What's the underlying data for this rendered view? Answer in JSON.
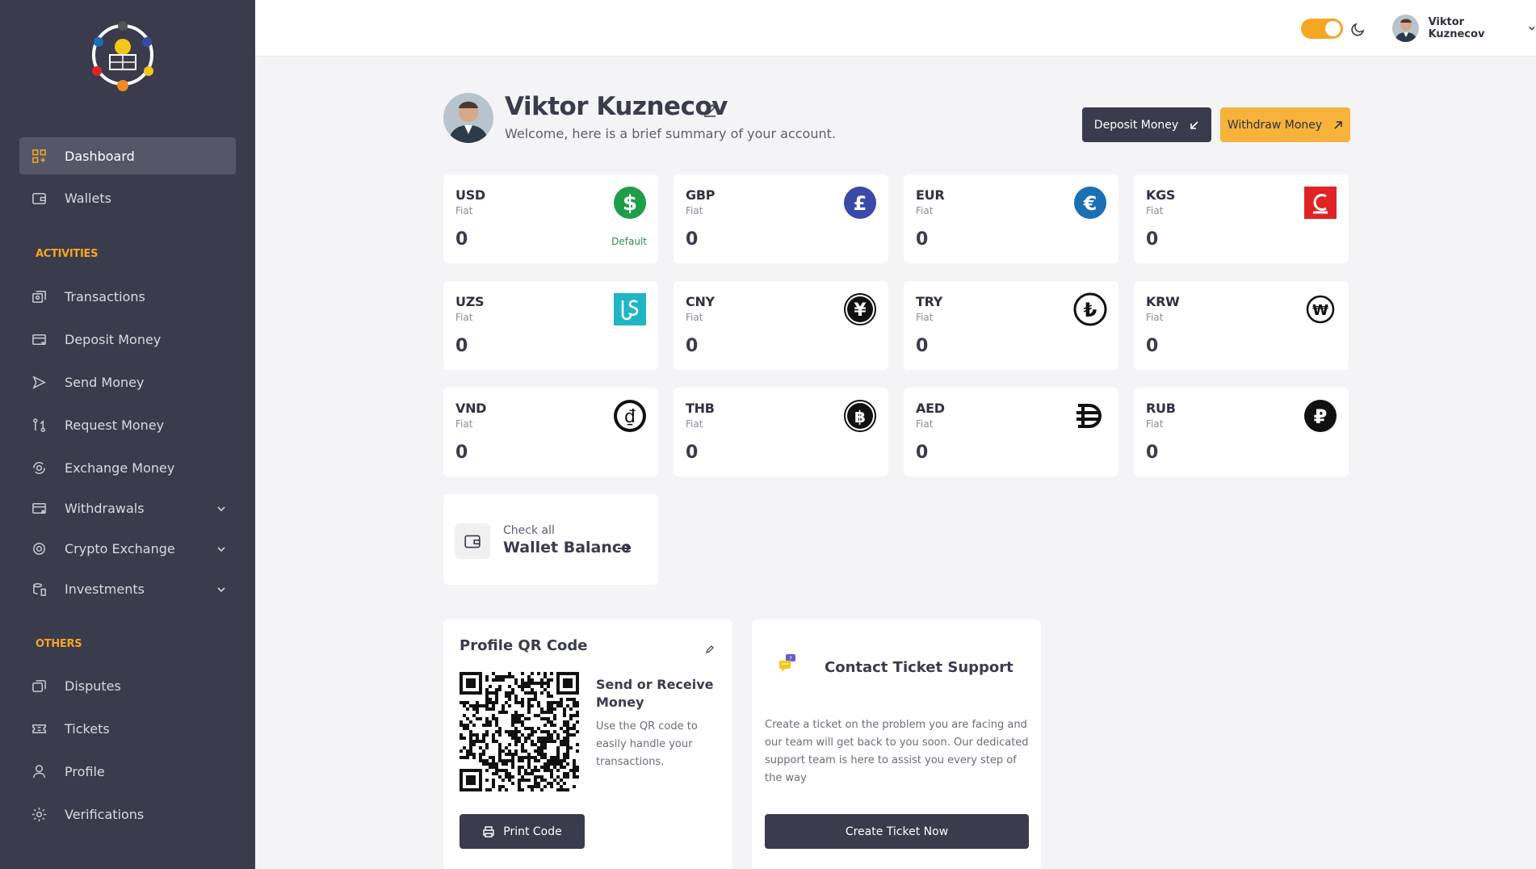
{
  "sidebar": {
    "items": [
      {
        "label": "Dashboard",
        "icon": "dashboard-icon",
        "active": true
      },
      {
        "label": "Wallets",
        "icon": "wallet-icon"
      },
      {
        "label": "Transactions",
        "icon": "transactions-icon"
      },
      {
        "label": "Deposit Money",
        "icon": "deposit-icon"
      },
      {
        "label": "Send Money",
        "icon": "send-icon"
      },
      {
        "label": "Request Money",
        "icon": "request-icon"
      },
      {
        "label": "Exchange Money",
        "icon": "exchange-icon"
      },
      {
        "label": "Withdrawals",
        "icon": "withdrawals-icon",
        "expandable": true
      },
      {
        "label": "Crypto Exchange",
        "icon": "crypto-exchange-icon",
        "expandable": true
      },
      {
        "label": "Investments",
        "icon": "investments-icon",
        "expandable": true
      },
      {
        "label": "Disputes",
        "icon": "disputes-icon"
      },
      {
        "label": "Tickets",
        "icon": "tickets-icon"
      },
      {
        "label": "Profile",
        "icon": "profile-icon"
      },
      {
        "label": "Verifications",
        "icon": "verifications-icon"
      }
    ],
    "sections": {
      "activities": "ACTIVITIES",
      "others": "OTHERS"
    }
  },
  "topbar": {
    "user_name": "Viktor Kuznecov",
    "theme_toggle_on": true
  },
  "profile": {
    "name": "Viktor Kuznecov",
    "welcome": "Welcome, here is a brief summary of your account."
  },
  "actions": {
    "deposit_label": "Deposit Money",
    "withdraw_label": "Withdraw Money"
  },
  "currencies": [
    {
      "code": "USD",
      "type": "Fiat",
      "amount": "0",
      "badge": "Default",
      "icon": "dollar-icon",
      "color": "#1e9e4a"
    },
    {
      "code": "GBP",
      "type": "Fiat",
      "amount": "0",
      "badge": "",
      "icon": "pound-icon",
      "color": "#3a4aa8"
    },
    {
      "code": "EUR",
      "type": "Fiat",
      "amount": "0",
      "badge": "",
      "icon": "euro-icon",
      "color": "#1a6fb5"
    },
    {
      "code": "KGS",
      "type": "Fiat",
      "amount": "0",
      "badge": "",
      "icon": "som-icon",
      "color": "#e02424"
    },
    {
      "code": "UZS",
      "type": "Fiat",
      "amount": "0",
      "badge": "",
      "icon": "uzs-icon",
      "color": "#1fb5c4"
    },
    {
      "code": "CNY",
      "type": "Fiat",
      "amount": "0",
      "badge": "",
      "icon": "yuan-icon",
      "color": "#111111"
    },
    {
      "code": "TRY",
      "type": "Fiat",
      "amount": "0",
      "badge": "",
      "icon": "lira-icon",
      "color": "#111111"
    },
    {
      "code": "KRW",
      "type": "Fiat",
      "amount": "0",
      "badge": "",
      "icon": "won-icon",
      "color": "#111111"
    },
    {
      "code": "VND",
      "type": "Fiat",
      "amount": "0",
      "badge": "",
      "icon": "dong-icon",
      "color": "#111111"
    },
    {
      "code": "THB",
      "type": "Fiat",
      "amount": "0",
      "badge": "",
      "icon": "baht-icon",
      "color": "#111111"
    },
    {
      "code": "AED",
      "type": "Fiat",
      "amount": "0",
      "badge": "",
      "icon": "dirham-icon",
      "color": "#111111"
    },
    {
      "code": "RUB",
      "type": "Fiat",
      "amount": "0",
      "badge": "",
      "icon": "ruble-icon",
      "color": "#111111"
    }
  ],
  "wallet_balance": {
    "small": "Check all",
    "big": "Wallet Balance"
  },
  "qr_card": {
    "title": "Profile QR Code",
    "heading": "Send or Receive Money",
    "description": "Use the QR code to easily handle your transactions.",
    "print_label": "Print Code"
  },
  "ticket_card": {
    "title": "Contact Ticket Support",
    "description": "Create a ticket on the problem you are facing and our team will get back to you soon. Our dedicated support team is here to assist you every step of the way",
    "button_label": "Create Ticket Now"
  },
  "colors": {
    "sidebar_bg": "#3a3b4c",
    "accent": "#f5a623",
    "dark_button": "#3a3b4c"
  }
}
